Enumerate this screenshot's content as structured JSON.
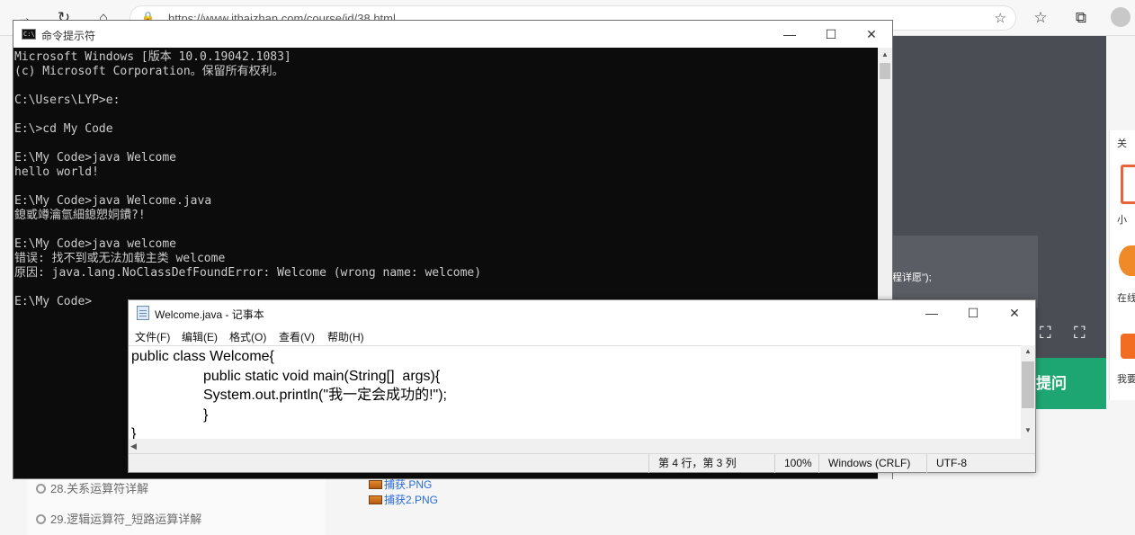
{
  "browser": {
    "url": "https://www.ithaizhan.com/course/id/38.html",
    "icons": [
      "back-arrow-icon",
      "refresh-icon",
      "home-icon",
      "lock-icon",
      "add-favorite-icon",
      "favorites-icon",
      "collections-icon",
      "profile-icon"
    ]
  },
  "page": {
    "video_caption": "程详愿\");",
    "ask_button": "提问",
    "right_rail": [
      "关",
      "小",
      "在线",
      "我要"
    ],
    "sidebar_items": [
      "28.关系运算符详解",
      "29.逻辑运算符_短路运算详解"
    ],
    "attachments": [
      "捕获.PNG",
      "捕获2.PNG"
    ]
  },
  "cmd": {
    "title": "命令提示符",
    "icon_text": "C:\\",
    "controls": {
      "minimize": "—",
      "maximize": "☐",
      "close": "✕"
    },
    "lines": [
      "Microsoft Windows [版本 10.0.19042.1083]",
      "(c) Microsoft Corporation。保留所有权利。",
      "",
      "C:\\Users\\LYP>e:",
      "",
      "E:\\>cd My Code",
      "",
      "E:\\My Code>java Welcome",
      "hello world!",
      "",
      "E:\\My Code>java Welcome.java",
      "鎴戜竴瀹氫細鎴愬姛鐨?!",
      "",
      "E:\\My Code>java welcome",
      "错误: 找不到或无法加载主类 welcome",
      "原因: java.lang.NoClassDefFoundError: Welcome (wrong name: welcome)",
      "",
      "E:\\My Code>"
    ]
  },
  "notepad": {
    "title": "Welcome.java - 记事本",
    "controls": {
      "minimize": "—",
      "maximize": "☐",
      "close": "✕"
    },
    "menu": [
      "文件(F)",
      "编辑(E)",
      "格式(O)",
      "查看(V)",
      "帮助(H)"
    ],
    "lines": [
      "public class Welcome{",
      "\t\tpublic static void main(String[]  args){",
      "\t\tSystem.out.println(\"我一定会成功的!\");",
      "\t\t}",
      "}"
    ],
    "status": {
      "position": "第 4 行，第 3 列",
      "zoom": "100%",
      "line_ending": "Windows (CRLF)",
      "encoding": "UTF-8"
    }
  }
}
